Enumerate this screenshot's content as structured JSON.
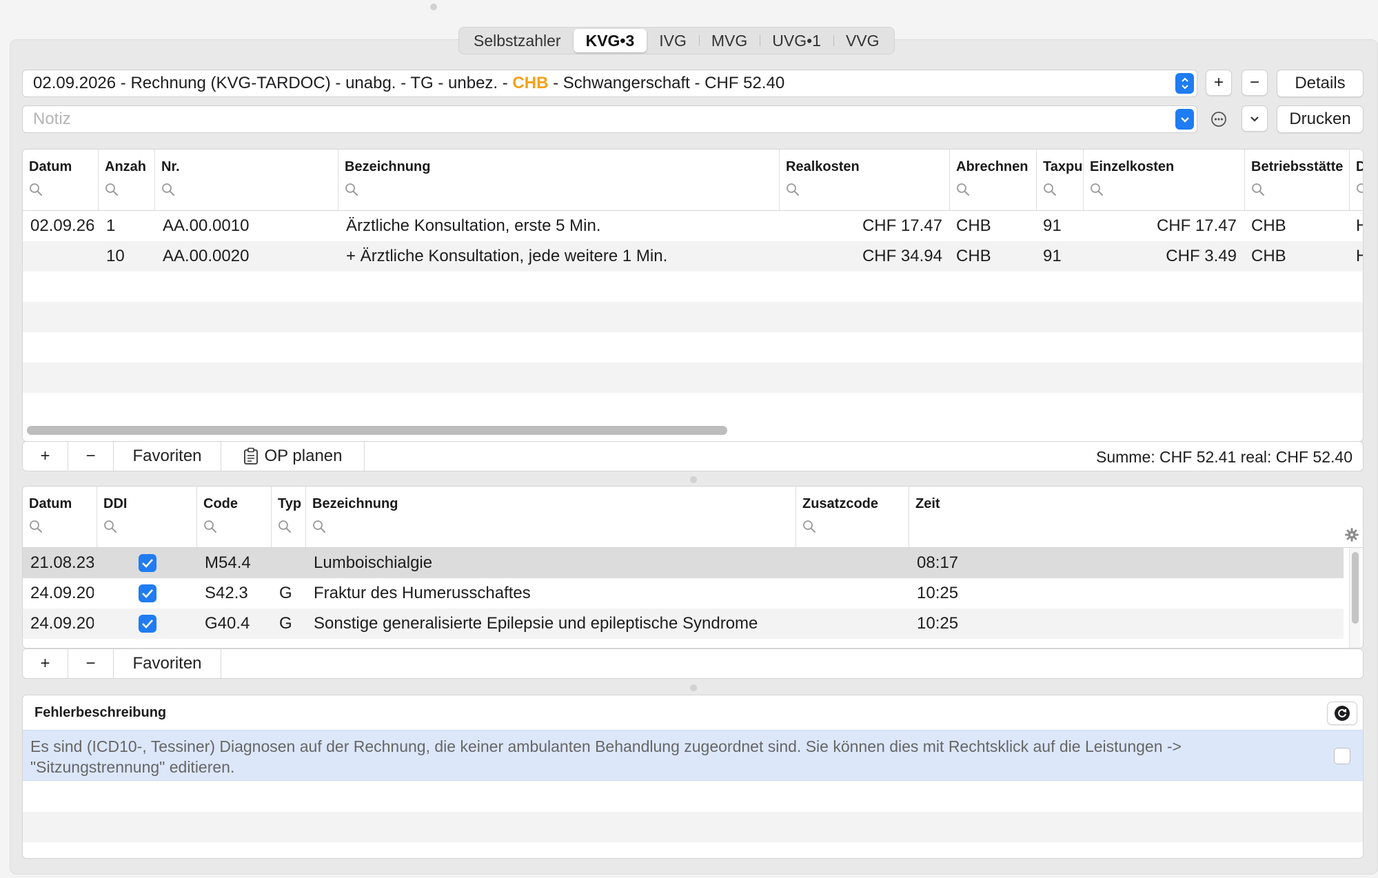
{
  "tabs": [
    "Selbstzahler",
    "KVG•3",
    "IVG",
    "MVG",
    "UVG•1",
    "VVG"
  ],
  "active_tab": "KVG•3",
  "invoice_selector": {
    "prefix": "02.09.2026 - Rechnung (KVG-TARDOC) - unabg. - TG - unbez. - ",
    "highlight": "CHB",
    "suffix": " - Schwangerschaft - CHF 52.40"
  },
  "buttons": {
    "add": "+",
    "remove": "−",
    "details": "Details",
    "print": "Drucken"
  },
  "note": {
    "placeholder": "Notiz",
    "value": ""
  },
  "services": {
    "columns": [
      "Datum",
      "Anzah",
      "Nr.",
      "Bezeichnung",
      "Realkosten",
      "Abrechnen",
      "Taxpu",
      "Einzelkosten",
      "Betriebsstätte",
      "D"
    ],
    "rows": [
      {
        "datum": "02.09.26",
        "anzahl": "1",
        "nr": "AA.00.0010",
        "bezeichnung": "Ärztliche Konsultation, erste 5 Min.",
        "realkosten": "CHF 17.47",
        "abrechnen": "CHB",
        "taxpunkte": "91",
        "einzelkosten": "CHF 17.47",
        "betriebsstaette": "CHB",
        "d": "H"
      },
      {
        "datum": "",
        "anzahl": "10",
        "nr": "AA.00.0020",
        "bezeichnung": "+ Ärztliche Konsultation, jede weitere 1 Min.",
        "realkosten": "CHF 34.94",
        "abrechnen": "CHB",
        "taxpunkte": "91",
        "einzelkosten": "CHF 3.49",
        "betriebsstaette": "CHB",
        "d": "H"
      }
    ]
  },
  "services_toolbar": {
    "add": "+",
    "remove": "−",
    "favorites": "Favoriten",
    "op_plan": "OP planen",
    "sum": "Summe: CHF 52.41 real: CHF 52.40"
  },
  "diagnoses": {
    "columns": [
      "Datum",
      "DDI",
      "Code",
      "Typ",
      "Bezeichnung",
      "Zusatzcode",
      "Zeit"
    ],
    "rows": [
      {
        "datum": "21.08.23",
        "ddi": true,
        "code": "M54.4",
        "typ": "",
        "bezeichnung": "Lumboischialgie",
        "zusatzcode": "",
        "zeit": "08:17",
        "selected": true
      },
      {
        "datum": "24.09.20",
        "ddi": true,
        "code": "S42.3",
        "typ": "G",
        "bezeichnung": "Fraktur des Humerusschaftes",
        "zusatzcode": "",
        "zeit": "10:25",
        "selected": false
      },
      {
        "datum": "24.09.20",
        "ddi": true,
        "code": "G40.4",
        "typ": "G",
        "bezeichnung": "Sonstige generalisierte Epilepsie und epileptische Syndrome",
        "zusatzcode": "",
        "zeit": "10:25",
        "selected": false
      }
    ]
  },
  "diagnoses_toolbar": {
    "add": "+",
    "remove": "−",
    "favorites": "Favoriten"
  },
  "errors": {
    "title": "Fehlerbeschreibung",
    "message_line1": "Es sind (ICD10-, Tessiner) Diagnosen auf der Rechnung, die keiner ambulanten Behandlung zugeordnet sind. Sie können dies mit Rechtsklick auf die Leistungen ->",
    "message_line2": "\"Sitzungstrennung\" editieren."
  },
  "colors": {
    "accent": "#1f7cf2",
    "chb_highlight": "#f3a21a",
    "error_row": "#dce7fa"
  },
  "icons": [
    "search-icon",
    "stepper-icon",
    "chevron-down-icon",
    "ellipsis-icon",
    "clipboard-icon",
    "gear-icon",
    "refresh-icon",
    "checkbox-icon"
  ]
}
